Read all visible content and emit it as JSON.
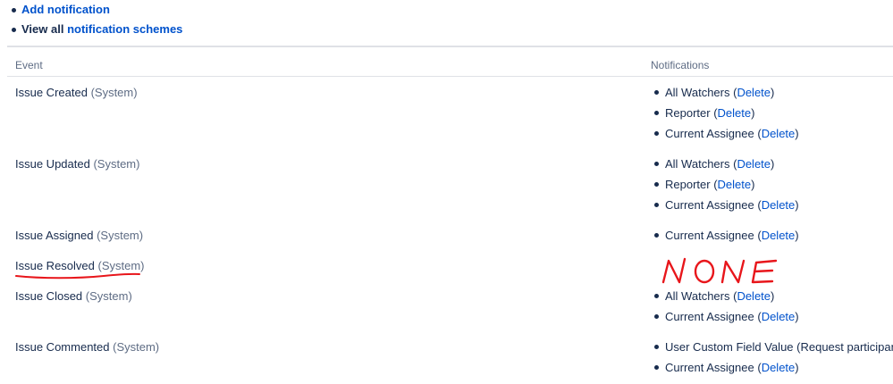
{
  "actions": {
    "add_notification": "Add notification",
    "view_all_prefix": "View all",
    "view_all_link": "notification schemes"
  },
  "table": {
    "headers": {
      "event": "Event",
      "notifications": "Notifications"
    },
    "delete_label": "Delete",
    "rows": [
      {
        "event": "Issue Created",
        "system": "(System)",
        "notifications": [
          "All Watchers",
          "Reporter",
          "Current Assignee"
        ]
      },
      {
        "event": "Issue Updated",
        "system": "(System)",
        "notifications": [
          "All Watchers",
          "Reporter",
          "Current Assignee"
        ]
      },
      {
        "event": "Issue Assigned",
        "system": "(System)",
        "notifications": [
          "Current Assignee"
        ]
      },
      {
        "event": "Issue Resolved",
        "system": "(System)",
        "notifications": []
      },
      {
        "event": "Issue Closed",
        "system": "(System)",
        "notifications": [
          "All Watchers",
          "Current Assignee"
        ]
      },
      {
        "event": "Issue Commented",
        "system": "(System)",
        "notifications": [
          "User Custom Field Value (Request participan",
          "Current Assignee"
        ]
      }
    ]
  },
  "annotation": {
    "handwritten_text": "NONE",
    "color": "#e8161b"
  },
  "colors": {
    "link": "#0052cc",
    "text": "#172b4d",
    "muted": "#5e6c84"
  }
}
